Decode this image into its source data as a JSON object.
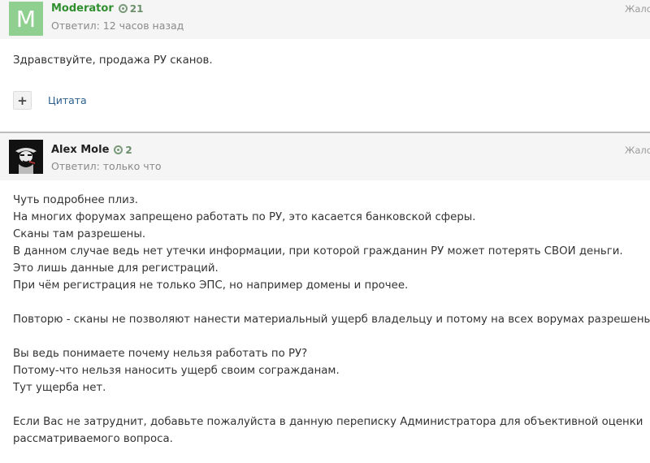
{
  "posts": [
    {
      "avatar_letter": "M",
      "author": "Moderator",
      "reputation": "21",
      "meta": "Ответил: 12 часов назад",
      "report": "Жало",
      "body": [
        "Здравствуйте, продажа РУ сканов."
      ],
      "quote_label": "Цитата",
      "plus_label": "+",
      "colors": {
        "avatar_bg": "#8fcf8f",
        "author": "#2f8f2f"
      }
    },
    {
      "author": "Alex Mole",
      "reputation": "2",
      "meta": "Ответил: только что",
      "report": "Жало",
      "body": [
        "Чуть подробнее плиз.",
        "На многих форумах запрещено работать по РУ, это касается банковской сферы.",
        "Сканы там разрешены.",
        "В данном случае ведь нет утечки информации, при которой гражданин РУ может потерять СВОИ деньги.",
        "Это лишь данные для регистраций.",
        "При чём регистрация не только ЭПС, но например домены и прочее.",
        "",
        "Повторю - сканы не позволяют нанести материальный ущерб владельцу и потому на всех ворумах разрешены.",
        "",
        "Вы ведь понимаете почему нельзя работать по РУ?",
        "Потому-что нельзя наносить ущерб своим согражданам.",
        "Тут ущерба нет.",
        "",
        "Если Вас не затруднит, добавьте пожалуйста в данную переписку Администратора для объективной оценки",
        "рассматриваемого вопроса."
      ],
      "colors": {
        "avatar_bg": "#111111",
        "author": "#222222"
      }
    }
  ]
}
